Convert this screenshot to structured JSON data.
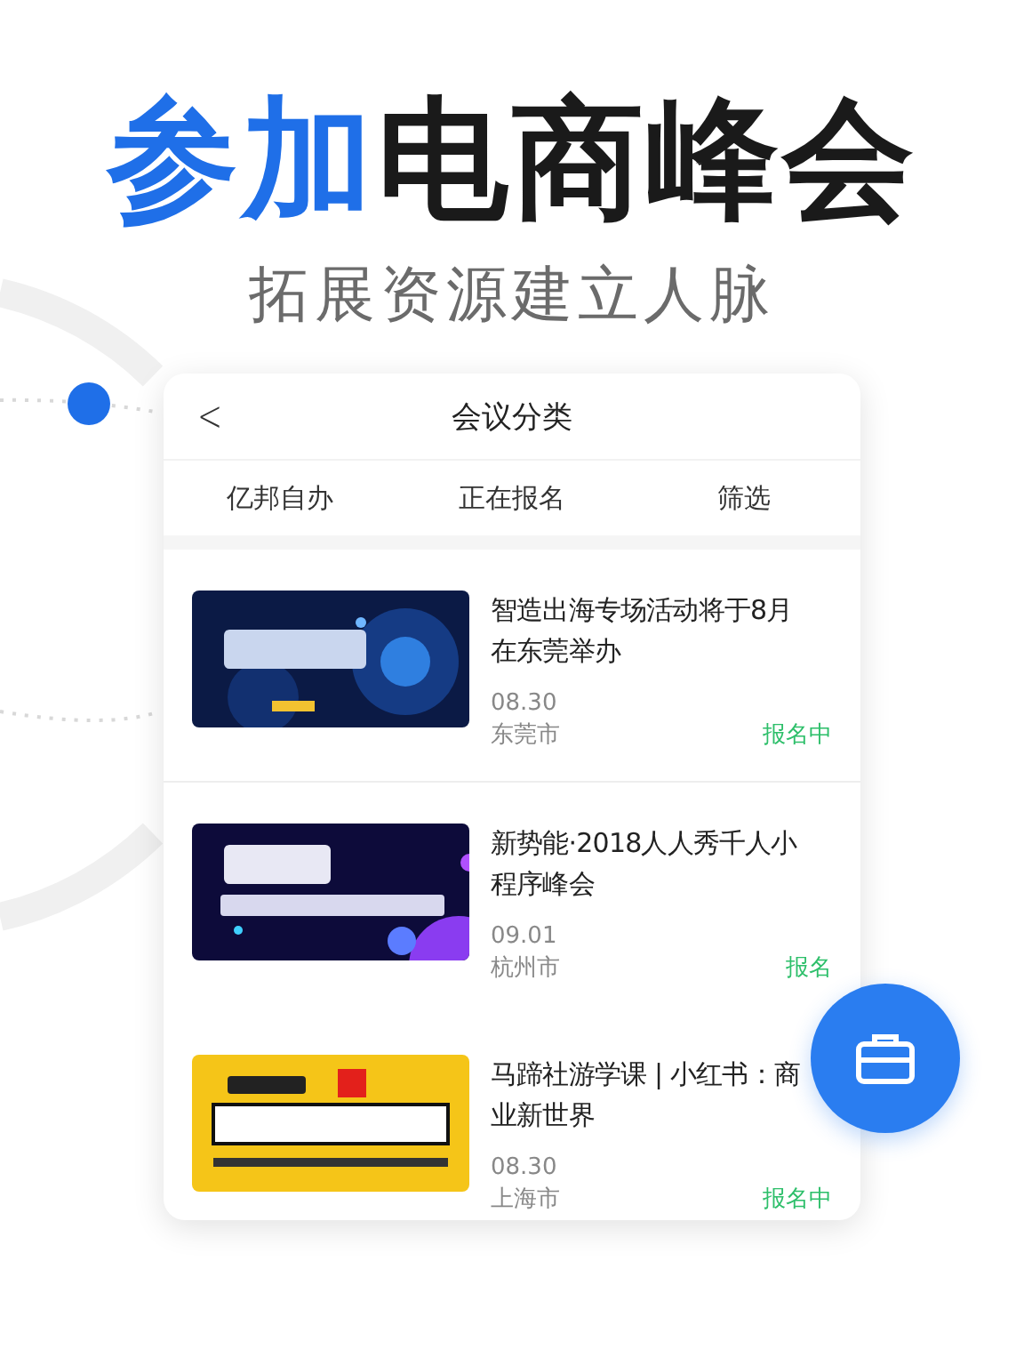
{
  "headline": [
    {
      "text": "参加",
      "highlight": true
    },
    {
      "text": "电商峰会",
      "highlight": false
    }
  ],
  "subtitle": "拓展资源建立人脉",
  "screen": {
    "title": "会议分类",
    "back_icon": "<",
    "filters": [
      "亿邦自办",
      "正在报名",
      "筛选"
    ],
    "events": [
      {
        "title": "智造出海专场活动将于8月在东莞举办",
        "date": "08.30",
        "city": "东莞市",
        "status": "报名中"
      },
      {
        "title": "新势能·2018人人秀千人小程序峰会",
        "date": "09.01",
        "city": "杭州市",
        "status": "报名"
      },
      {
        "title": "马蹄社游学课 | 小红书：商业新世界",
        "date": "08.30",
        "city": "上海市",
        "status": "报名中"
      }
    ]
  }
}
